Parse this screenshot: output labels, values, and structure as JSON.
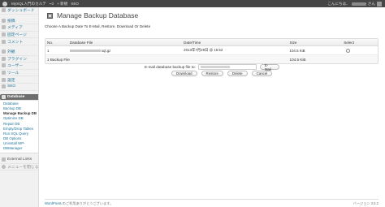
{
  "adminbar": {
    "site_name": "MySQL入門のカルテ",
    "comments": "0",
    "new_label": "+ 新規",
    "seo_label": "SEO",
    "greeting": "こんにちは、"
  },
  "sidebar": {
    "items": [
      {
        "label": "ダッシュボード",
        "icon": "dashboard-icon"
      },
      {
        "label": "投稿",
        "icon": "posts-icon"
      },
      {
        "label": "メディア",
        "icon": "media-icon"
      },
      {
        "label": "固定ページ",
        "icon": "pages-icon"
      },
      {
        "label": "コメント",
        "icon": "comments-icon"
      },
      {
        "label": "外観",
        "icon": "appearance-icon"
      },
      {
        "label": "プラグイン",
        "icon": "plugins-icon"
      },
      {
        "label": "ユーザー",
        "icon": "users-icon"
      },
      {
        "label": "ツール",
        "icon": "tools-icon"
      },
      {
        "label": "設定",
        "icon": "settings-icon"
      },
      {
        "label": "SEO",
        "icon": "seo-icon"
      }
    ],
    "current": {
      "label": "Database",
      "icon": "database-icon"
    },
    "submenu": [
      "Database",
      "Backup DB",
      "Manage Backup DB",
      "Optimize DB",
      "Repair DB",
      "Empty/Drop Tables",
      "Run SQL Query",
      "DB Options",
      "Uninstall WP-",
      "DBManager"
    ],
    "external": {
      "label": "External Links",
      "icon": "external-links-icon"
    },
    "collapse": {
      "label": "メニューを閉じる",
      "icon": "collapse-icon"
    }
  },
  "page": {
    "title": "Manage Backup Database",
    "instructions": "Choose A Backup Date To E-Mail, Restore, Download Or Delete"
  },
  "table": {
    "headers": [
      "No.",
      "Database File",
      "Date/Time",
      "Size",
      "Select"
    ],
    "rows": [
      {
        "no": "1",
        "file": "sql.gz",
        "date": "2013年7月29日 @ 15:52",
        "size": "104.5 KiB"
      }
    ],
    "footer": {
      "count": "1 Backup File",
      "total": "104.5 KiB"
    }
  },
  "email": {
    "label": "E-mail database backup file to:",
    "button": "E-Mail"
  },
  "actions": [
    "Download",
    "Restore",
    "Delete",
    "Cancel"
  ],
  "footer": {
    "link": "WordPress",
    "thanks": " のご利用ありがとうございます。",
    "version": "バージョン 3.5.2"
  }
}
